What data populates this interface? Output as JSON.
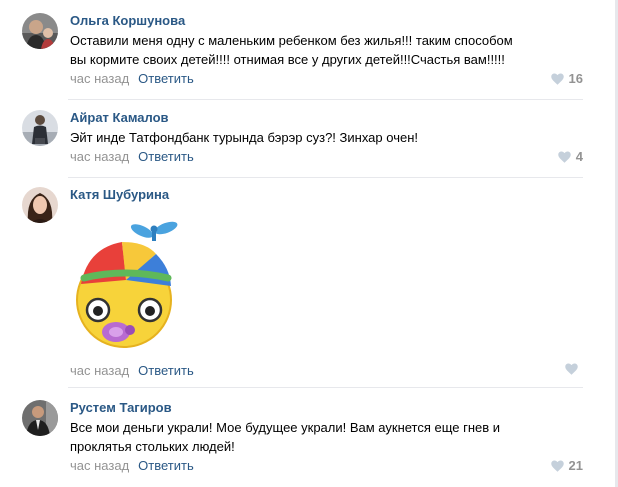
{
  "comments": [
    {
      "author": "Ольга Коршунова",
      "lines": [
        "Оставили меня одну с маленьким ребенком без жилья!!! таким способом",
        "вы кормите своих детей!!!! отнимая все у других детей!!!Счастья вам!!!!!"
      ],
      "time": "час назад",
      "reply": "Ответить",
      "likes": "16",
      "avatar": "avatar"
    },
    {
      "author": "Айрат Камалов",
      "lines": [
        "Эйт инде Татфондбанк турында бэрэр суз?! Зинхар очен!"
      ],
      "time": "час назад",
      "reply": "Ответить",
      "likes": "4",
      "avatar": "avatar"
    },
    {
      "author": "Катя Шубурина",
      "sticker": "baby-propeller-cap-sticker",
      "time": "час назад",
      "reply": "Ответить",
      "likes": "",
      "avatar": "avatar"
    },
    {
      "author": "Рустем Тагиров",
      "lines": [
        "Все мои деньги украли! Мое будущее украли! Вам аукнется еще гнев и",
        "проклятья стольких людей!"
      ],
      "time": "час назад",
      "reply": "Ответить",
      "likes": "21",
      "avatar": "avatar"
    }
  ],
  "colors": {
    "author": "#2a5885",
    "meta": "#939393",
    "like_icon": "#c5d0db",
    "separator": "#e7e8ec"
  },
  "icons": {
    "like": "heart-icon"
  }
}
